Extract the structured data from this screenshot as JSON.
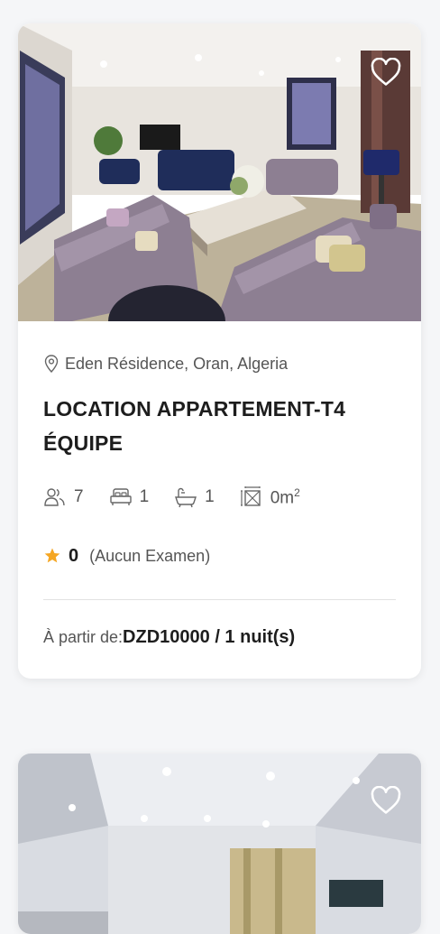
{
  "listing1": {
    "location": "Eden Résidence, Oran, Algeria",
    "title_line1": "LOCATION APPARTEMENT-T4",
    "title_line2": "ÉQUIPE",
    "amenities": {
      "guests": "7",
      "beds": "1",
      "baths": "1",
      "area": "0m",
      "area_sup": "2"
    },
    "rating": {
      "value": "0",
      "reviews": "(Aucun Examen)",
      "star_color": "#f5a623"
    },
    "price": {
      "prefix": "À partir de:",
      "amount": "DZD10000 / 1 nuit(s)"
    },
    "icons": [
      "heart-icon",
      "location-pin-icon",
      "guests-icon",
      "bed-icon",
      "bath-icon",
      "area-icon",
      "star-icon"
    ]
  },
  "listing2": {
    "icons": [
      "heart-icon"
    ]
  }
}
